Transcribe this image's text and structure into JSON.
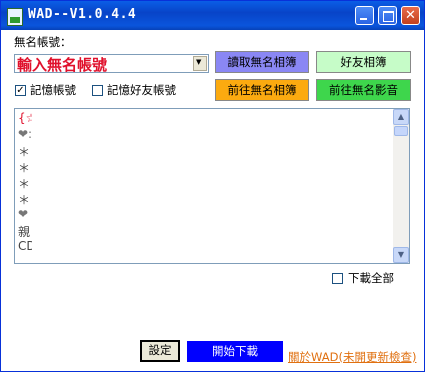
{
  "window": {
    "title": "WAD--V1.0.4.4"
  },
  "account": {
    "label": "無名帳號：",
    "combo_value": "輸入無名帳號",
    "remember_account": "記憶帳號",
    "remember_account_checked": true,
    "remember_friend": "記憶好友帳號",
    "remember_friend_checked": false
  },
  "buttons": {
    "read_album": "讀取無名相簿",
    "friend_album": "好友相簿",
    "goto_album": "前往無名相簿",
    "goto_video": "前往無名影音",
    "settings": "設定",
    "start_download": "開始下載",
    "about": "關於WAD(未開更新檢查)"
  },
  "list": {
    "items": [
      "{☆",
      "❤:",
      "＊",
      "＊",
      "＊",
      "＊",
      "❤",
      "親",
      "CD"
    ]
  },
  "download_all": {
    "label": "下載全部",
    "checked": false
  },
  "colors": {
    "read_album": "#8a87f4",
    "friend_album": "#c6fcc8",
    "goto_album": "#fbaa10",
    "goto_video": "#3ed64c",
    "start_download": "#0000ff"
  }
}
